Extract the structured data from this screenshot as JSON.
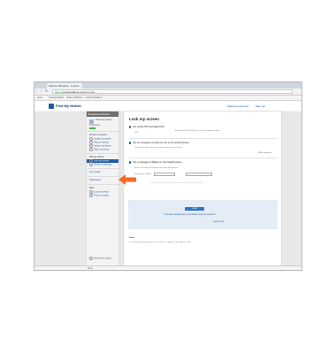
{
  "browser": {
    "tab_title": "Verizon Wireless - Lock & ...",
    "url_host": "https://",
    "url_path": "wirelessdirect.verizon.com/...",
    "bookmarks": [
      "Apps",
      "Getting Started",
      "Verizon Wireless",
      "Latest Headlines"
    ]
  },
  "site": {
    "brand": "Find My Mobile",
    "header_links": [
      "Samsung account",
      "Sign out"
    ]
  },
  "sidebar": {
    "header": "Registered device",
    "user_lines": [
      "Samsung Galaxy",
      "Connected",
      "Online"
    ],
    "sections": [
      {
        "title": "Protect my device",
        "items": [
          "Locate my device",
          "Ring my device",
          "Unlock my device",
          "Wipe my device"
        ]
      },
      {
        "title": "Privacy options",
        "items": [
          "Lock my screen",
          "Retrieve calls/logs"
        ]
      }
    ],
    "active_item": "Lock my screen",
    "extra_links": [
      "Set up lock",
      "Notifications"
    ],
    "more_title": "More",
    "more_items": [
      "Lock my device",
      "Find my mobile"
    ],
    "footer": "Check lock status"
  },
  "main": {
    "title": "Lock my screen",
    "option1": "Set unlock PIN (4-8 digits PIN)",
    "option1_note": "Entering a PIN (4-8 digits) to set your device to lock",
    "pin_label": "PIN",
    "option2": "Set an emergency contact for use on the locked screen",
    "option2_note": "This allows others to see the phone number you choose",
    "option3": "Set a message to display on your locked screen",
    "message_label": "Enter a message for anyone who finds your device",
    "contact_label": "Emergency number",
    "button_label": "Lock",
    "link1": "To ensure a proper lock, your device must be turned on",
    "link2": "Learn more",
    "note_title": "Notice",
    "note_text": "Lock functions may not work if your device is offline or the battery is low."
  },
  "status": "Done"
}
